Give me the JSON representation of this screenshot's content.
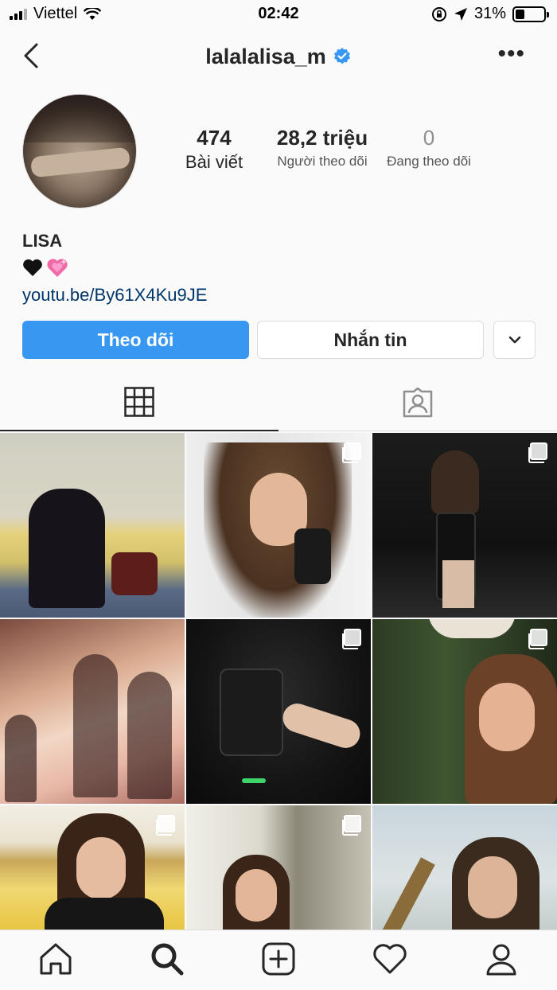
{
  "status_bar": {
    "carrier": "Viettel",
    "time": "02:42",
    "battery_percent": "31%",
    "battery_level": 0.31
  },
  "header": {
    "username": "lalalalisa_m",
    "verified": true
  },
  "profile": {
    "stats": {
      "posts_count": "474",
      "posts_label": "Bài viết",
      "followers_count": "28,2 triệu",
      "followers_label": "Người theo dõi",
      "following_count": "0",
      "following_label": "Đang theo dõi"
    },
    "display_name": "LISA",
    "bio_emoji": [
      "black-heart",
      "sparkling-pink-heart"
    ],
    "link": "youtu.be/By61X4Ku9JE"
  },
  "actions": {
    "follow_label": "Theo dõi",
    "message_label": "Nhắn tin"
  },
  "colors": {
    "accent": "#3897f0",
    "link": "#003569",
    "verified": "#3897f0",
    "border": "#dbdbdb"
  },
  "tabs": [
    {
      "name": "grid",
      "icon": "grid-icon",
      "active": true
    },
    {
      "name": "tagged",
      "icon": "tagged-photos-icon",
      "active": false
    }
  ],
  "bottom_nav": [
    {
      "icon": "home-icon"
    },
    {
      "icon": "search-icon",
      "active": true
    },
    {
      "icon": "add-post-icon"
    },
    {
      "icon": "activity-heart-icon"
    },
    {
      "icon": "profile-icon"
    }
  ]
}
